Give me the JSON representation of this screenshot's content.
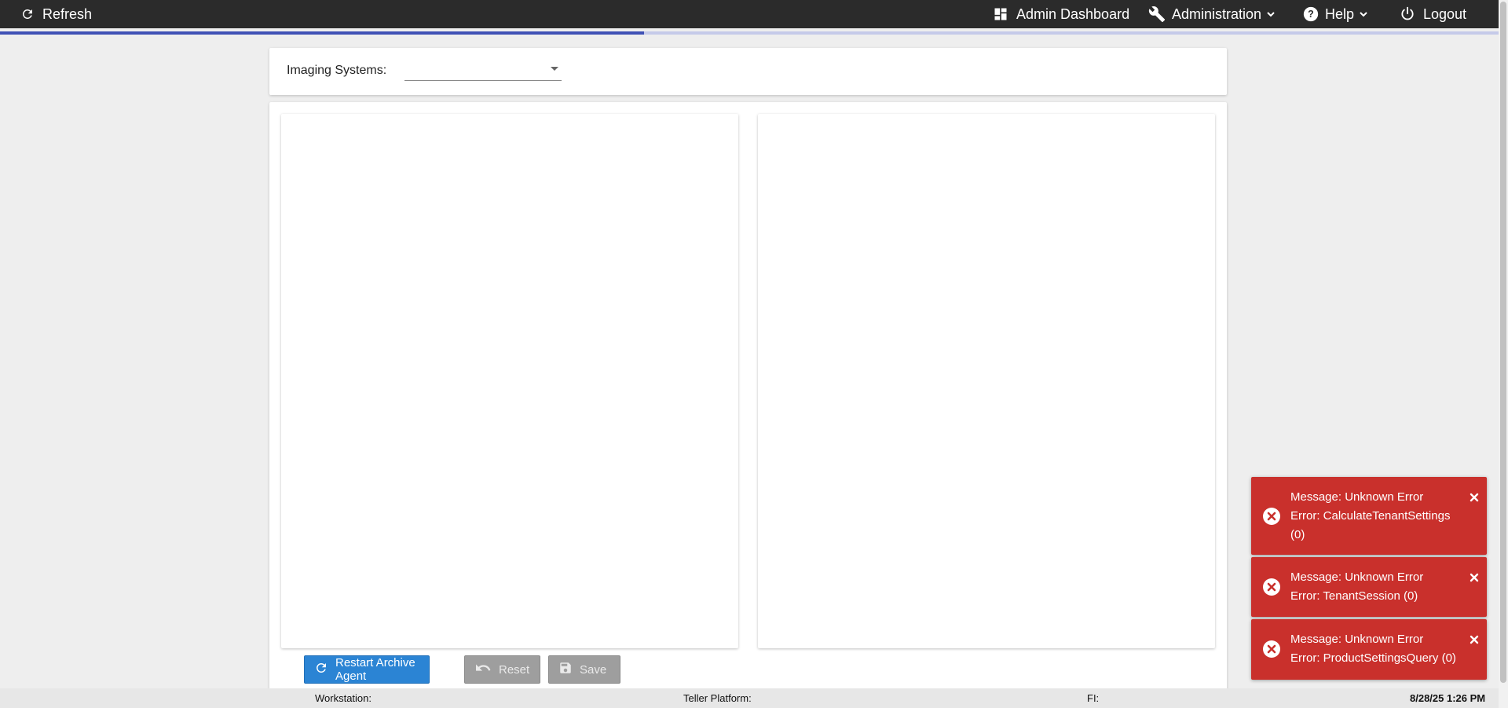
{
  "topbar": {
    "refresh_label": "Refresh",
    "admin_dashboard_label": "Admin Dashboard",
    "administration_label": "Administration",
    "help_label": "Help",
    "logout_label": "Logout",
    "icons": {
      "refresh": "refresh-icon",
      "dashboard": "dashboard-icon",
      "administration": "wrench-icon",
      "help": "help-icon",
      "logout": "power-icon"
    }
  },
  "loading_progress_percent": 43,
  "filter": {
    "imaging_systems_label": "Imaging Systems:",
    "imaging_systems_value": ""
  },
  "actions": {
    "restart_label": "Restart Archive Agent",
    "reset_label": "Reset",
    "save_label": "Save"
  },
  "statusbar": {
    "workstation_label": "Workstation:",
    "teller_platform_label": "Teller Platform:",
    "fi_label": "FI:",
    "datetime": "8/28/25 1:26 PM"
  },
  "toasts": [
    {
      "lines": [
        "Message: Unknown Error",
        "Error: CalculateTenantSettings",
        "(0)"
      ]
    },
    {
      "lines": [
        "Message: Unknown Error",
        "Error: TenantSession (0)"
      ]
    },
    {
      "lines": [
        "Message: Unknown Error",
        "Error: ProductSettingsQuery (0)"
      ]
    }
  ],
  "colors": {
    "topbar": "#2b2b2b",
    "progress": "#3f51b5",
    "primary_button": "#2b84d4",
    "toast_error": "#c9302c"
  }
}
